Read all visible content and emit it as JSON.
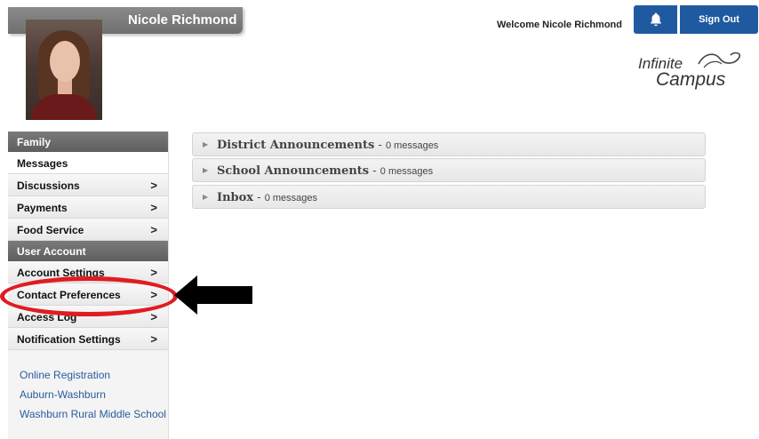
{
  "header": {
    "user_name": "Nicole Richmond",
    "welcome": "Welcome Nicole Richmond",
    "sign_out": "Sign Out",
    "notification_icon": "bell-icon",
    "logo_line1": "Infinite",
    "logo_line2": "Campus"
  },
  "sidebar": {
    "family_heading": "Family",
    "family_items": [
      {
        "label": "Messages"
      },
      {
        "label": "Discussions"
      },
      {
        "label": "Payments"
      },
      {
        "label": "Food Service"
      }
    ],
    "account_heading": "User Account",
    "account_items": [
      {
        "label": "Account Settings"
      },
      {
        "label": "Contact Preferences"
      },
      {
        "label": "Access Log"
      },
      {
        "label": "Notification Settings"
      }
    ],
    "links": [
      {
        "label": "Online Registration"
      },
      {
        "label": "Auburn-Washburn"
      },
      {
        "label": "Washburn Rural Middle School"
      }
    ],
    "chevron": ">"
  },
  "main": {
    "panels": [
      {
        "title": "District Announcements",
        "count": "0 messages"
      },
      {
        "title": "School Announcements",
        "count": "0 messages"
      },
      {
        "title": "Inbox",
        "count": "0 messages"
      }
    ],
    "separator": " - ",
    "expand_icon": "▶"
  },
  "colors": {
    "brand_blue": "#1f5aa0",
    "annotation_red": "#e11b22",
    "section_gray": "#6f6f6f"
  }
}
